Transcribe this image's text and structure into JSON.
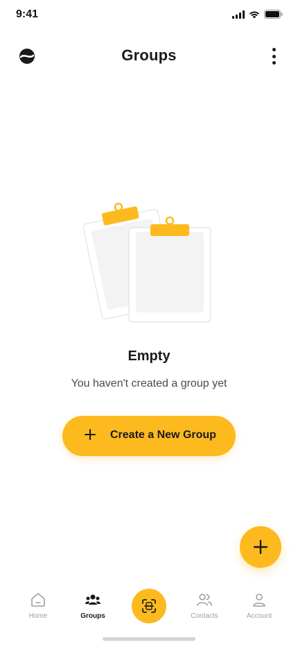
{
  "status_bar": {
    "time": "9:41",
    "icons": [
      "signal-icon",
      "wifi-icon",
      "battery-icon"
    ]
  },
  "header": {
    "title": "Groups",
    "logo_icon": "app-logo-icon",
    "menu_icon": "more-vertical-icon"
  },
  "empty_state": {
    "illustration_icon": "clipboards-icon",
    "title": "Empty",
    "message": "You haven't created a group yet",
    "button_label": "Create a New Group",
    "button_icon": "plus-icon"
  },
  "fab": {
    "icon": "plus-icon"
  },
  "bottom_nav": {
    "items": [
      {
        "label": "Home",
        "icon": "home-icon",
        "active": false
      },
      {
        "label": "Groups",
        "icon": "groups-icon",
        "active": true
      },
      {
        "label": "",
        "icon": "scan-icon",
        "active": false
      },
      {
        "label": "Contacts",
        "icon": "contacts-icon",
        "active": false
      },
      {
        "label": "Account",
        "icon": "account-icon",
        "active": false
      }
    ]
  },
  "colors": {
    "accent": "#FDBA1F",
    "text_primary": "#1A1A1A",
    "text_secondary": "#4A4A4A",
    "text_muted": "#9E9E9E",
    "illustration_fill": "#F3F3F3"
  }
}
